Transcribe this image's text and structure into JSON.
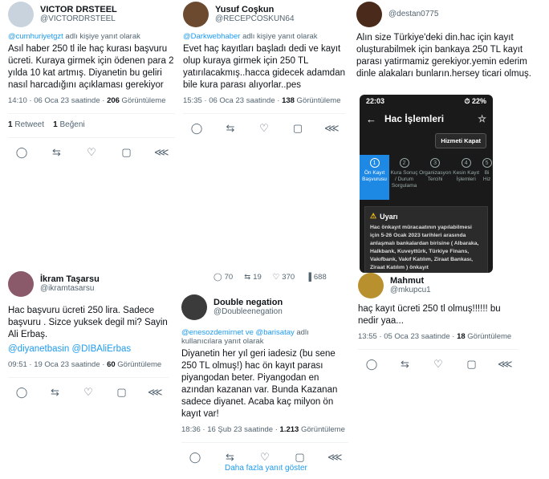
{
  "tweets": {
    "t1": {
      "name": "VICTOR DRSTEEL",
      "handle": "@VICTORDRSTEEL",
      "reply_mention": "@cumhuriyetgzt",
      "reply_suffix": " adlı kişiye yanıt olarak",
      "text": "Asıl haber 250 tl ile haç kurası başvuru ücreti. Kuraya girmek için ödenen para 2 yılda 10 kat artmış. Diyanetin bu geliri nasıl harcadığını açıklaması gerekiyor",
      "time": "14:10 · 06 Oca 23 saatinde · ",
      "views_num": "206",
      "views_label": " Görüntüleme",
      "stat1_num": "1",
      "stat1_label": " Retweet",
      "stat2_num": "1",
      "stat2_label": " Beğeni"
    },
    "t2": {
      "name": "Yusuf Coşkun",
      "handle": "@RECEPCOSKUN64",
      "reply_mention": "@Darkwebhaber",
      "reply_suffix": " adlı kişiye yanıt olarak",
      "text": "Evet haç kayıtları başladı dedi ve kayıt olup kuraya girmek için 250 TL yatırılacakmış..hacca gidecek adamdan bile kura parası alıyorlar..pes",
      "time": "15:35 · 06 Oca 23 saatinde · ",
      "views_num": "138",
      "views_label": " Görüntüleme"
    },
    "t3": {
      "handle": "@destan0775",
      "text": "Alın size Türkiye'deki din.hac için kayıt oluşturabilmek için bankaya 250 TL kayıt parası yatirmamiz gerekiyor.yemin ederim dinle alakaları bunların.hersey ticari olmuş."
    },
    "t4": {
      "name": "İkram Taşarsu",
      "handle": "@ikramtasarsu",
      "text": "Hac başvuru ücreti 250 lira. Sadece başvuru . Sizce yuksek degil mi? Sayin Ali Erbaş.",
      "mentions": "@diyanetbasin @DIBAliErbas",
      "time": "09:51 · 19 Oca 23 saatinde · ",
      "views_num": "60",
      "views_label": " Görüntüleme"
    },
    "t5_stats": {
      "replies": "70",
      "retweets": "19",
      "likes": "370",
      "views": "688"
    },
    "t5": {
      "name": "Double negation",
      "handle": "@Doubleenegation",
      "reply_mention": "@enesozdemirnet ve @barisatay",
      "reply_suffix": " adlı kullanıcılara yanıt olarak",
      "text": "Diyanetin her yıl geri iadesiz (bu sene 250 TL olmuş!) hac ön kayıt parası piyangodan beter. Piyangodan en azından kazanan var. Bunda Kazanan sadece diyanet. Acaba kaç milyon ön kayıt var!",
      "time": "18:36 · 16 Şub 23 saatinde · ",
      "views_num": "1.213",
      "views_label": " Görüntüleme",
      "more": "Daha fazla yanıt göster"
    },
    "t6": {
      "name": "Mahmut",
      "handle": "@mkupcu1",
      "text": "haç kayıt ücreti 250 tl olmuş!!!!!! bu nedir yaa...",
      "time": "13:55 · 05 Oca 23 saatinde · ",
      "views_num": "18",
      "views_label": " Görüntüleme"
    }
  },
  "phone": {
    "time": "22:03",
    "battery": "22%",
    "title": "Hac İşlemleri",
    "button": "Hizmeti Kapat",
    "steps": [
      "Ön Kayıt Başvurusu",
      "Kura Sonuç / Durum Sorgulama",
      "Organizasyon Tercihi",
      "Kesin Kayıt İşlemleri",
      "Bi Hiz"
    ],
    "warning_title": "Uyarı",
    "warning_text": "Hac önkayıt müracaatının yapılabilmesi için 5-26 Ocak 2023 tarihleri arasında anlaşmalı bankalardan birisine ( Albaraka, Halkbank, Kuveyttürk, Türkiye Finans, Vakıfbank, Vakıf Katılım, Ziraat Bankası, Ziraat Katılım ) önkayıt"
  },
  "colors": {
    "link": "#1d9bf0",
    "muted": "#536471",
    "active_step": "#1e88e5"
  }
}
